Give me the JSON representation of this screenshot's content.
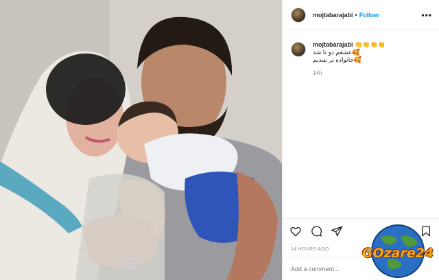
{
  "post": {
    "username": "mojtabarajabi",
    "separator": "•",
    "follow_label": "Follow",
    "more_label": "•••"
  },
  "caption": {
    "username": "mojtabarajabi",
    "emoji_line": "👏👏👏👏",
    "line1": "🥰عشقم دو تا شد",
    "line2": "🥰خانواده تر شدیم",
    "age": "14h"
  },
  "footer": {
    "timestamp": "14 HOURS AGO",
    "comment_placeholder": "Add a comment..."
  },
  "watermark": {
    "brand": "GOzare24"
  },
  "icons": {
    "like": "heart-icon",
    "comment": "comment-icon",
    "share": "send-icon",
    "save": "bookmark-icon"
  },
  "colors": {
    "link": "#0095f6",
    "text": "#262626",
    "muted": "#8e8e8e",
    "watermark_orange": "#f5a524"
  }
}
